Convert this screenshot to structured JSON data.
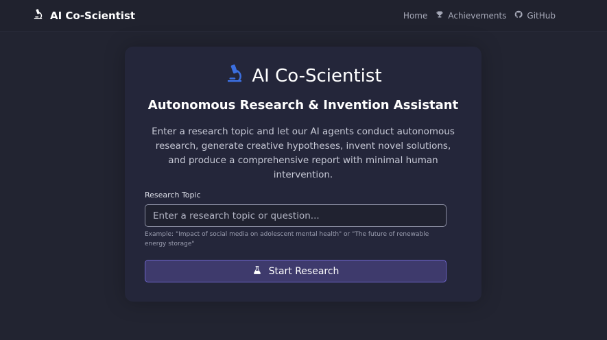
{
  "navbar": {
    "brand": "AI Co-Scientist",
    "brand_icon": "microscope-icon",
    "links": [
      {
        "label": "Home",
        "icon": ""
      },
      {
        "label": "Achievements",
        "icon": "trophy-icon"
      },
      {
        "label": "GitHub",
        "icon": "github-icon"
      }
    ]
  },
  "hero": {
    "title": "AI Co-Scientist",
    "title_icon": "microscope-icon",
    "subtitle": "Autonomous Research & Invention Assistant",
    "description": "Enter a research topic and let our AI agents conduct autonomous research, generate creative hypotheses, invent novel solutions, and produce a comprehensive report with minimal human intervention."
  },
  "form": {
    "label": "Research Topic",
    "placeholder": "Enter a research topic or question...",
    "value": "",
    "hint": "Example: \"Impact of social media on adolescent mental health\" or \"The future of renewable energy storage\"",
    "button_label": "Start Research",
    "button_icon": "flask-icon"
  },
  "colors": {
    "background": "#222431",
    "card": "#24263a",
    "accent": "#3b6fe0",
    "button": "#3e3a6c",
    "button_border": "#6c63c8"
  }
}
